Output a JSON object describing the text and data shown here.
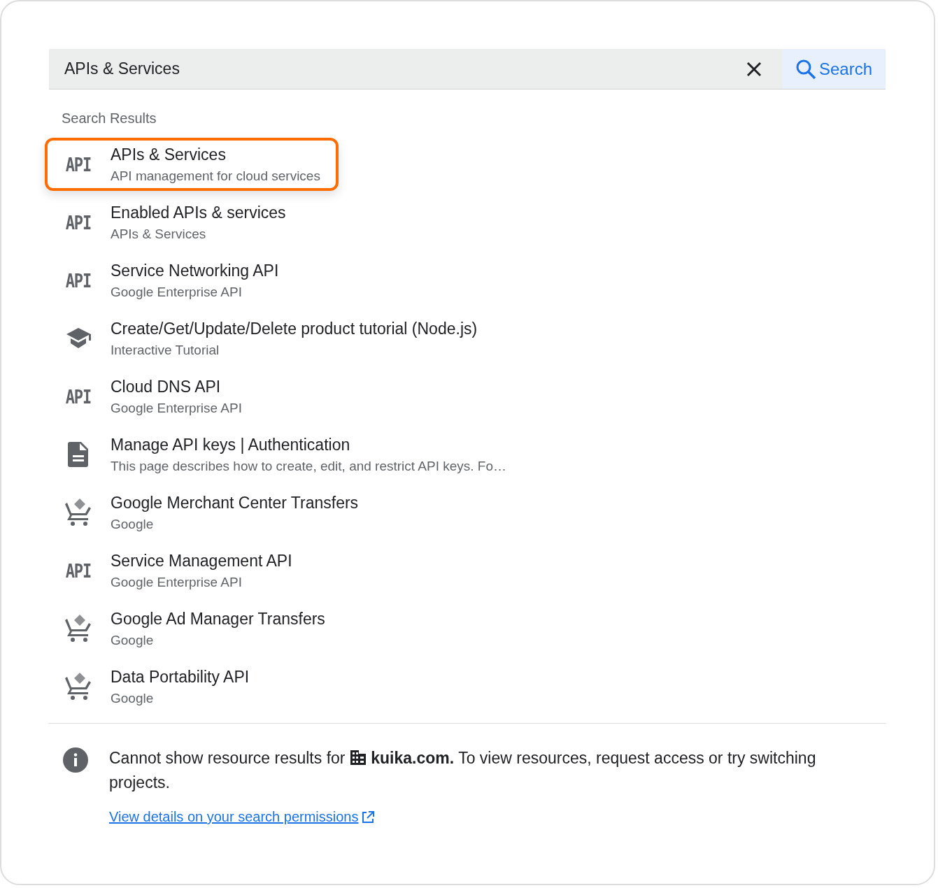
{
  "search": {
    "value": "APIs & Services",
    "button": "Search"
  },
  "results_heading": "Search Results",
  "results": [
    {
      "kind": "api",
      "icon_text": "API",
      "title": "APIs & Services",
      "subtitle": "API management for cloud services",
      "selected": true
    },
    {
      "kind": "api",
      "icon_text": "API",
      "title": "Enabled APIs & services",
      "subtitle": "APIs & Services",
      "selected": false
    },
    {
      "kind": "api",
      "icon_text": "API",
      "title": "Service Networking API",
      "subtitle": "Google Enterprise API",
      "selected": false
    },
    {
      "kind": "tutorial",
      "title": "Create/Get/Update/Delete product tutorial (Node.js)",
      "subtitle": "Interactive Tutorial",
      "selected": false
    },
    {
      "kind": "api",
      "icon_text": "API",
      "title": "Cloud DNS API",
      "subtitle": "Google Enterprise API",
      "selected": false
    },
    {
      "kind": "doc",
      "title": "Manage API keys | Authentication",
      "subtitle": "This page describes how to create, edit, and restrict API keys. Fo…",
      "selected": false
    },
    {
      "kind": "cart",
      "title": "Google Merchant Center Transfers",
      "subtitle": "Google",
      "selected": false
    },
    {
      "kind": "api",
      "icon_text": "API",
      "title": "Service Management API",
      "subtitle": "Google Enterprise API",
      "selected": false
    },
    {
      "kind": "cart",
      "title": "Google Ad Manager Transfers",
      "subtitle": "Google",
      "selected": false
    },
    {
      "kind": "cart",
      "title": "Data Portability API",
      "subtitle": "Google",
      "selected": false
    }
  ],
  "notice": {
    "prefix": "Cannot show resource results for",
    "rest": "**kuika.com.** To view resources, request access or try switching",
    "rest_end": "projects.",
    "link": "View details on your search permissions"
  }
}
